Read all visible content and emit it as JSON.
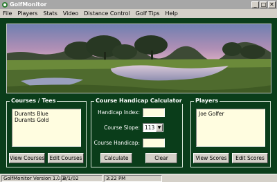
{
  "window": {
    "title": "GolfMonitor"
  },
  "window_buttons": {
    "minimize": "_",
    "maximize": "□",
    "close": "✕"
  },
  "menu": [
    "File",
    "Players",
    "Stats",
    "Video",
    "Distance Control",
    "Golf Tips",
    "Help"
  ],
  "courses": {
    "title": "Courses / Tees",
    "items": [
      "Durants Blue",
      "Durants Gold"
    ],
    "view_button": "View Courses",
    "edit_button": "Edit Courses"
  },
  "calculator": {
    "title": "Course Handicap Calculator",
    "handicap_index_label": "Handicap Index:",
    "handicap_index_value": "",
    "course_slope_label": "Course Slope:",
    "course_slope_value": "113",
    "course_handicap_label": "Course Handicap:",
    "course_handicap_value": "",
    "calculate_button": "Calculate",
    "clear_button": "Clear"
  },
  "players": {
    "title": "Players",
    "items": [
      "Joe Golfer"
    ],
    "view_button": "View Scores",
    "edit_button": "Edit Scores"
  },
  "status": {
    "version": "GolfMonitor Version 1.0.3",
    "date": "8/1/02",
    "time": "3:22 PM"
  },
  "colors": {
    "background": "#0a3d1a",
    "list_bg": "#fffde0",
    "chrome": "#d4d0c8"
  }
}
